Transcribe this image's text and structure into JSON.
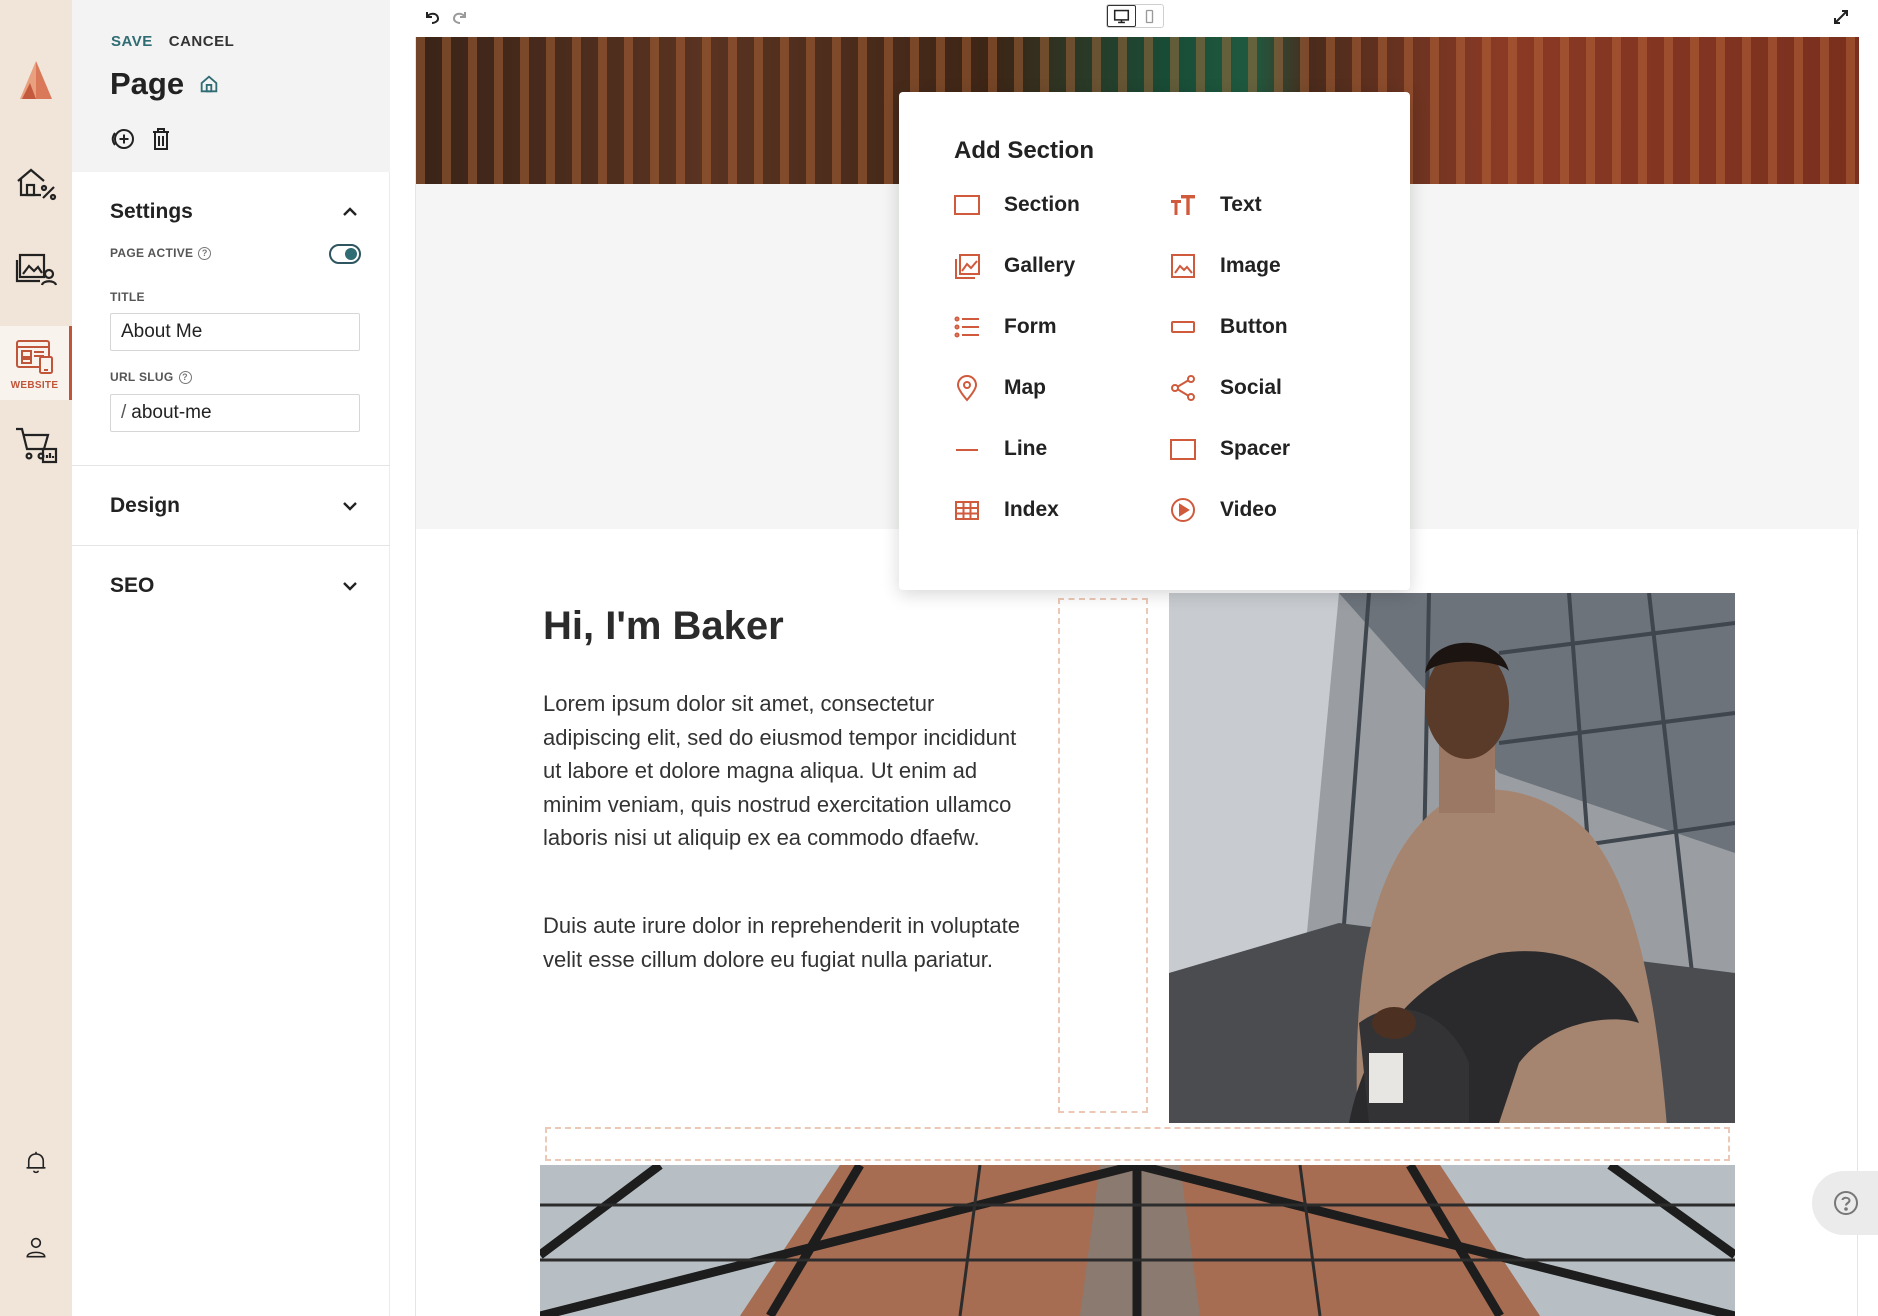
{
  "rail": {
    "website_label": "WEBSITE"
  },
  "panel": {
    "save_label": "SAVE",
    "cancel_label": "CANCEL",
    "page_title": "Page",
    "settings_label": "Settings",
    "page_active_label": "PAGE ACTIVE",
    "page_active": true,
    "title_label": "TITLE",
    "title_value": "About Me",
    "slug_label": "URL SLUG",
    "slug_prefix": "/",
    "slug_value": "about-me",
    "design_label": "Design",
    "seo_label": "SEO"
  },
  "popup": {
    "title": "Add Section",
    "items": [
      {
        "label": "Section",
        "icon": "section-icon"
      },
      {
        "label": "Text",
        "icon": "text-icon"
      },
      {
        "label": "Gallery",
        "icon": "gallery-icon"
      },
      {
        "label": "Image",
        "icon": "image-icon"
      },
      {
        "label": "Form",
        "icon": "form-icon"
      },
      {
        "label": "Button",
        "icon": "button-icon"
      },
      {
        "label": "Map",
        "icon": "map-pin-icon"
      },
      {
        "label": "Social",
        "icon": "share-icon"
      },
      {
        "label": "Line",
        "icon": "line-icon"
      },
      {
        "label": "Spacer",
        "icon": "spacer-icon"
      },
      {
        "label": "Index",
        "icon": "grid-icon"
      },
      {
        "label": "Video",
        "icon": "play-icon"
      }
    ]
  },
  "content": {
    "heading": "Hi, I'm Baker",
    "paragraph1": "Lorem ipsum dolor sit amet, consectetur adipiscing elit, sed do eiusmod tempor incididunt ut labore et dolore magna aliqua. Ut enim ad minim veniam, quis nostrud exercitation ullamco laboris nisi ut aliquip ex ea commodo dfaefw.",
    "paragraph2": "Duis aute irure dolor in reprehenderit in voluptate velit esse cillum dolore eu fugiat nulla pariatur."
  },
  "colors": {
    "accent": "#c0553a",
    "teal": "#2f6c73",
    "rail_bg": "#f1e4d8"
  }
}
